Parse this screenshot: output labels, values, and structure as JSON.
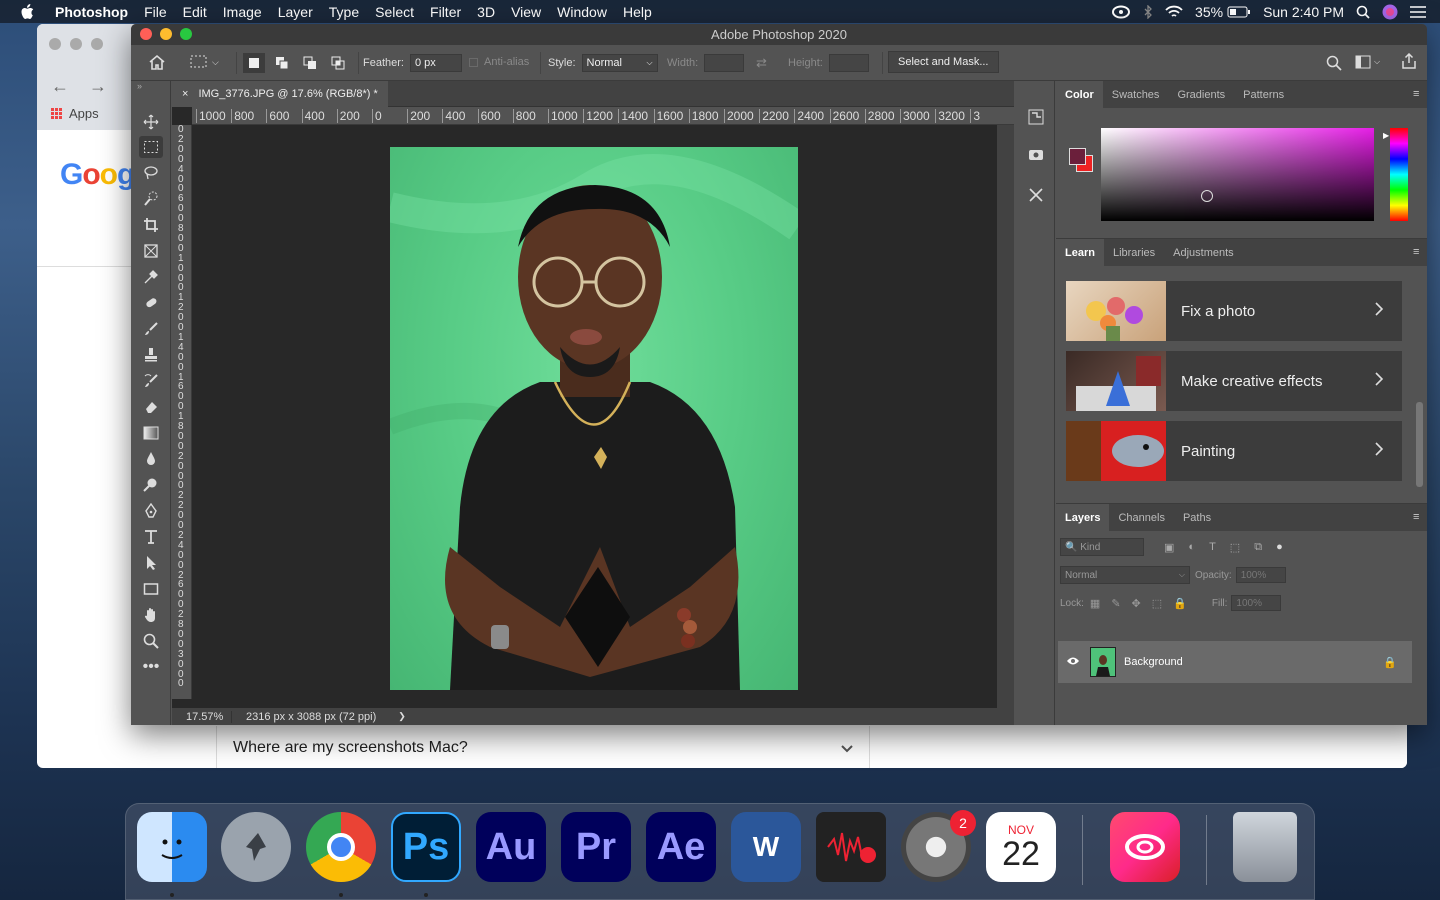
{
  "menubar": {
    "app": "Photoshop",
    "items": [
      "File",
      "Edit",
      "Image",
      "Layer",
      "Type",
      "Select",
      "Filter",
      "3D",
      "View",
      "Window",
      "Help"
    ],
    "battery": "35%",
    "clock": "Sun 2:40 PM"
  },
  "chrome": {
    "apps": "Apps",
    "google": [
      "G",
      "o",
      "o",
      "g"
    ],
    "faq": "Where are my screenshots Mac?"
  },
  "ps": {
    "title": "Adobe Photoshop 2020",
    "options": {
      "feather_label": "Feather:",
      "feather_value": "0 px",
      "antialias": "Anti-alias",
      "style_label": "Style:",
      "style_value": "Normal",
      "width_label": "Width:",
      "height_label": "Height:",
      "select_mask": "Select and Mask..."
    },
    "doc_tab": "IMG_3776.JPG @ 17.6% (RGB/8*) *",
    "ruler_h": [
      "1000",
      "800",
      "600",
      "400",
      "200",
      "0",
      "200",
      "400",
      "600",
      "800",
      "1000",
      "1200",
      "1400",
      "1600",
      "1800",
      "2000",
      "2200",
      "2400",
      "2600",
      "2800",
      "3000",
      "3200",
      "3"
    ],
    "ruler_v": [
      "0",
      "2",
      "0",
      "0",
      "4",
      "0",
      "0",
      "6",
      "0",
      "0",
      "8",
      "0",
      "0",
      "1",
      "0",
      "0",
      "0",
      "1",
      "2",
      "0",
      "0",
      "1",
      "4",
      "0",
      "0",
      "1",
      "6",
      "0",
      "0",
      "1",
      "8",
      "0",
      "0",
      "2",
      "0",
      "0",
      "0",
      "2",
      "2",
      "0",
      "0",
      "2",
      "4",
      "0",
      "0",
      "2",
      "6",
      "0",
      "0",
      "2",
      "8",
      "0",
      "0",
      "3",
      "0",
      "0",
      "0"
    ],
    "zoom": "17.57%",
    "doc_size": "2316 px x 3088 px (72 ppi)",
    "status_arrow": "❯",
    "color_tabs": [
      "Color",
      "Swatches",
      "Gradients",
      "Patterns"
    ],
    "learn_tabs": [
      "Learn",
      "Libraries",
      "Adjustments"
    ],
    "learn_cards": [
      "Fix a photo",
      "Make creative effects",
      "Painting"
    ],
    "layer_tabs": [
      "Layers",
      "Channels",
      "Paths"
    ],
    "kind": "Kind",
    "blend": "Normal",
    "opacity_label": "Opacity:",
    "opacity": "100%",
    "lock_label": "Lock:",
    "fill_label": "Fill:",
    "fill": "100%",
    "layer_name": "Background",
    "fg_color": "#6b1f3b",
    "bg_color": "#e22222"
  },
  "dock": {
    "ps": "Ps",
    "au": "Au",
    "pr": "Pr",
    "ae": "Ae",
    "word": "W",
    "prefs_badge": "2",
    "cal_month": "NOV",
    "cal_day": "22"
  }
}
